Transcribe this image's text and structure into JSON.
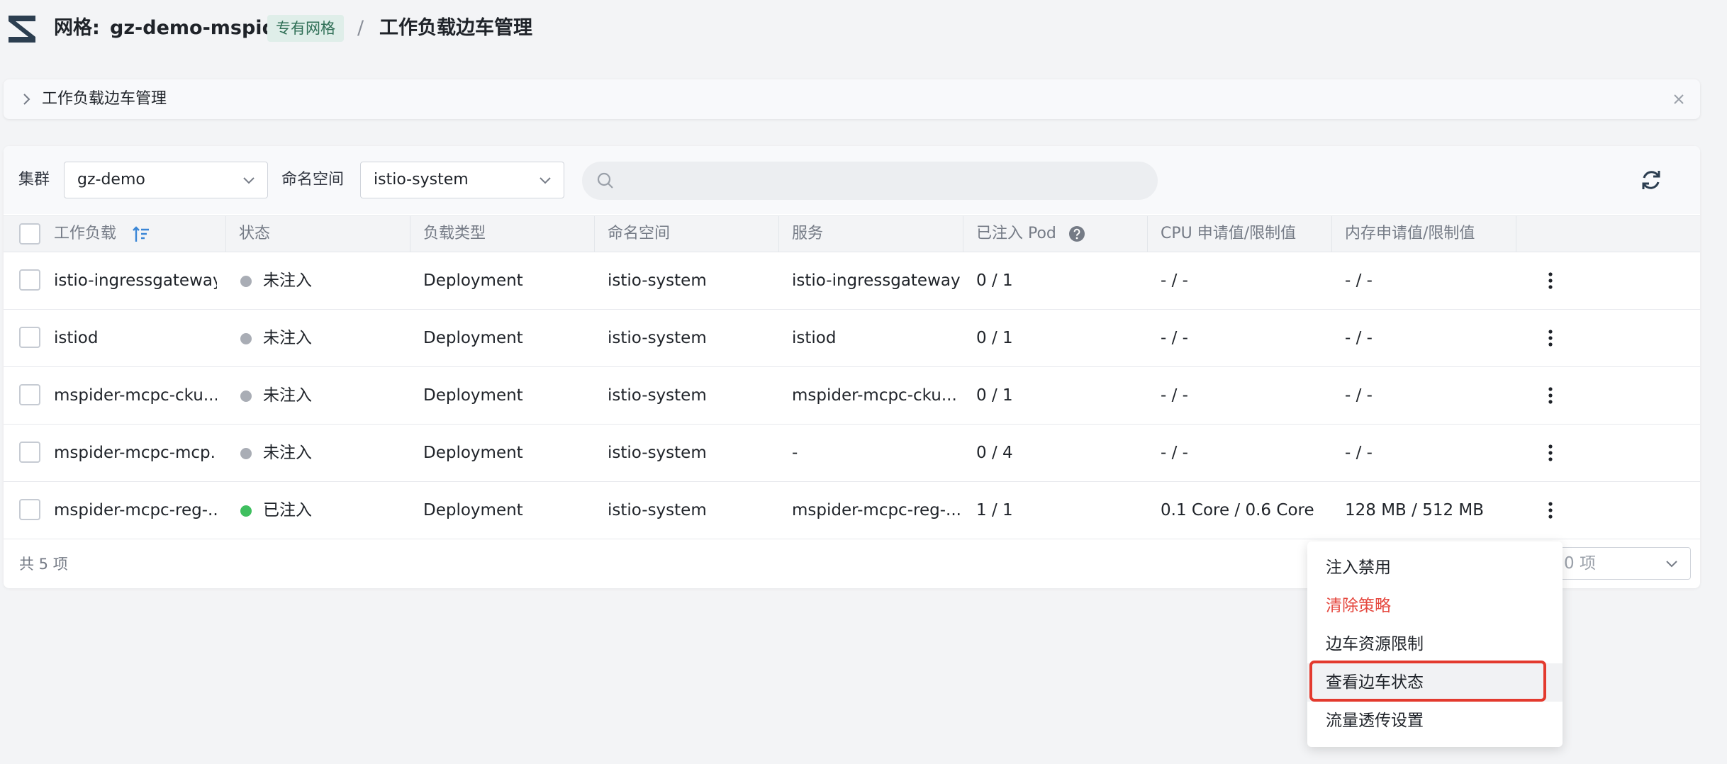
{
  "header": {
    "mesh_prefix": "网格:",
    "mesh_name": "gz-demo-mspider",
    "mesh_badge": "专有网格",
    "separator": "/",
    "page_title": "工作负载边车管理"
  },
  "banner": {
    "label": "工作负载边车管理"
  },
  "toolbar": {
    "cluster_label": "集群",
    "cluster_value": "gz-demo",
    "namespace_label": "命名空间",
    "namespace_value": "istio-system",
    "search_placeholder": ""
  },
  "table": {
    "headers": {
      "workload": "工作负载",
      "status": "状态",
      "type": "负载类型",
      "namespace": "命名空间",
      "service": "服务",
      "injected_pod": "已注入 Pod",
      "cpu": "CPU 申请值/限制值",
      "memory": "内存申请值/限制值"
    },
    "rows": [
      {
        "workload": "istio-ingressgateway",
        "status": "未注入",
        "status_color": "#a9adb5",
        "type": "Deployment",
        "namespace": "istio-system",
        "service": "istio-ingressgateway",
        "injected_pod": "0 / 1",
        "cpu": "- / -",
        "memory": "- / -"
      },
      {
        "workload": "istiod",
        "status": "未注入",
        "status_color": "#a9adb5",
        "type": "Deployment",
        "namespace": "istio-system",
        "service": "istiod",
        "injected_pod": "0 / 1",
        "cpu": "- / -",
        "memory": "- / -"
      },
      {
        "workload": "mspider-mcpc-cku...",
        "status": "未注入",
        "status_color": "#a9adb5",
        "type": "Deployment",
        "namespace": "istio-system",
        "service": "mspider-mcpc-cku...",
        "injected_pod": "0 / 1",
        "cpu": "- / -",
        "memory": "- / -"
      },
      {
        "workload": "mspider-mcpc-mcp...",
        "status": "未注入",
        "status_color": "#a9adb5",
        "type": "Deployment",
        "namespace": "istio-system",
        "service": "-",
        "injected_pod": "0 / 4",
        "cpu": "- / -",
        "memory": "- / -"
      },
      {
        "workload": "mspider-mcpc-reg-...",
        "status": "已注入",
        "status_color": "#3fbf5f",
        "type": "Deployment",
        "namespace": "istio-system",
        "service": "mspider-mcpc-reg-...",
        "injected_pod": "1 / 1",
        "cpu": "0.1 Core / 0.6 Core",
        "memory": "128 MB / 512 MB"
      }
    ]
  },
  "footer": {
    "count": "共 5 项",
    "page_size_partial": "0 项"
  },
  "menu": {
    "items": [
      "注入禁用",
      "清除策略",
      "边车资源限制",
      "查看边车状态",
      "流量透传设置"
    ]
  },
  "colors": {
    "danger": "#e5483f",
    "highlight": "#e33a2e",
    "accent": "#3a86d6"
  }
}
